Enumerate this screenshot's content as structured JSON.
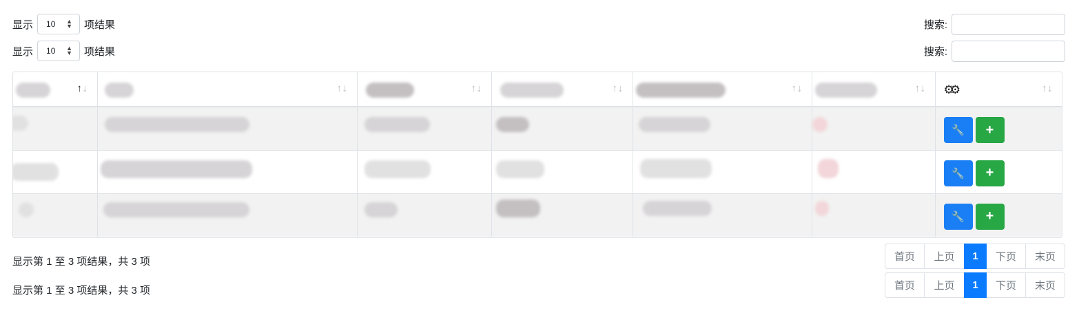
{
  "length_control": {
    "prefix": "显示",
    "value": "10",
    "suffix": "项结果"
  },
  "search": {
    "label": "搜索:",
    "value": ""
  },
  "table": {
    "actions_header_icon": "cogs-icon",
    "sort_icon_up": "↑",
    "sort_icon_down": "↓",
    "rows": 3,
    "action_edit_icon": "wrench-icon",
    "action_add_icon": "plus-icon",
    "action_edit_glyph": "🔧",
    "action_add_glyph": "+"
  },
  "info": {
    "text": "显示第 1 至 3 项结果，共 3 项"
  },
  "pagination": {
    "first": "首页",
    "prev": "上页",
    "current": "1",
    "next": "下页",
    "last": "末页"
  },
  "colors": {
    "primary": "#1a7ff5",
    "success": "#28a745",
    "active_page": "#0a7bff",
    "striped_row": "#f2f2f2"
  }
}
